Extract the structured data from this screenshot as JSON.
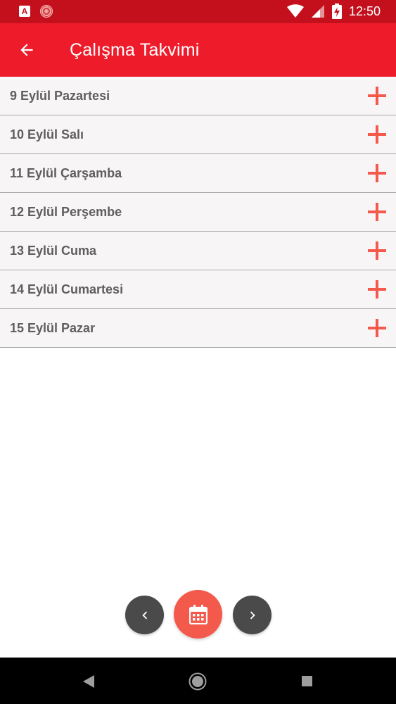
{
  "status_bar": {
    "time": "12:50",
    "notification_a_letter": "A"
  },
  "app_bar": {
    "title": "Çalışma Takvimi"
  },
  "days": [
    {
      "label": "9 Eylül Pazartesi"
    },
    {
      "label": "10 Eylül Salı"
    },
    {
      "label": "11 Eylül Çarşamba"
    },
    {
      "label": "12 Eylül Perşembe"
    },
    {
      "label": "13 Eylül Cuma"
    },
    {
      "label": "14 Eylül Cumartesi"
    },
    {
      "label": "15 Eylül Pazar"
    }
  ],
  "icons": {
    "back": "arrow-left-icon",
    "add": "plus-icon",
    "prev": "chevron-left-icon",
    "next": "chevron-right-icon",
    "calendar": "calendar-icon"
  },
  "colors": {
    "status_bar": "#c4101d",
    "app_bar": "#ee1c2b",
    "accent": "#f35a4c",
    "nav_button": "#4a4a4a",
    "row_bg": "#f8f5f7",
    "row_text": "#5e5e5e"
  }
}
